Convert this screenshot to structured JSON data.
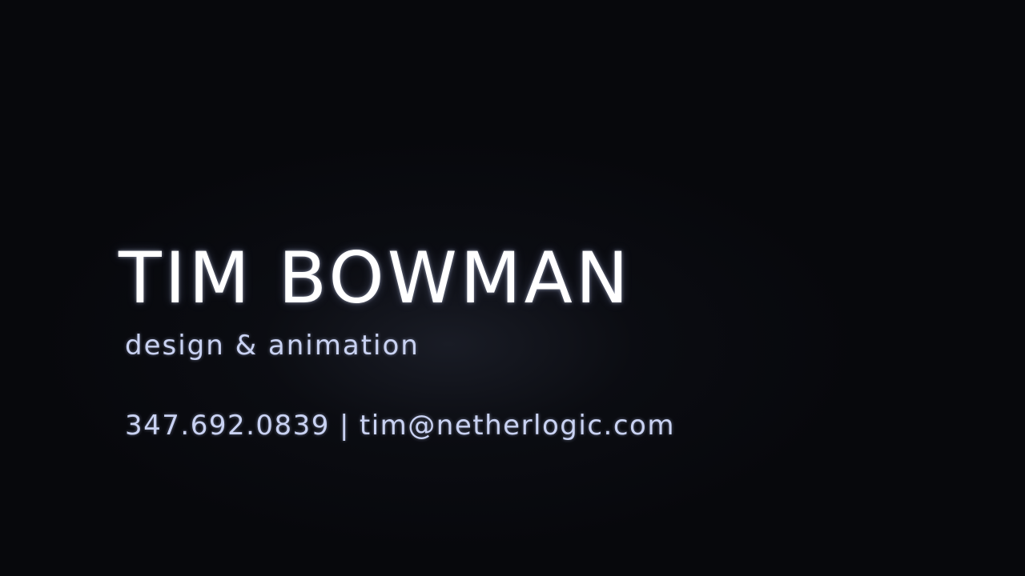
{
  "card": {
    "name": "TIM BOWMAN",
    "tagline": "design & animation",
    "phone": "347.692.0839",
    "separator": "|",
    "email": "tim@netherlogic.com"
  },
  "colors": {
    "background": "#07080c",
    "name_text": "#ffffff",
    "secondary_text": "#c9d2f2"
  }
}
